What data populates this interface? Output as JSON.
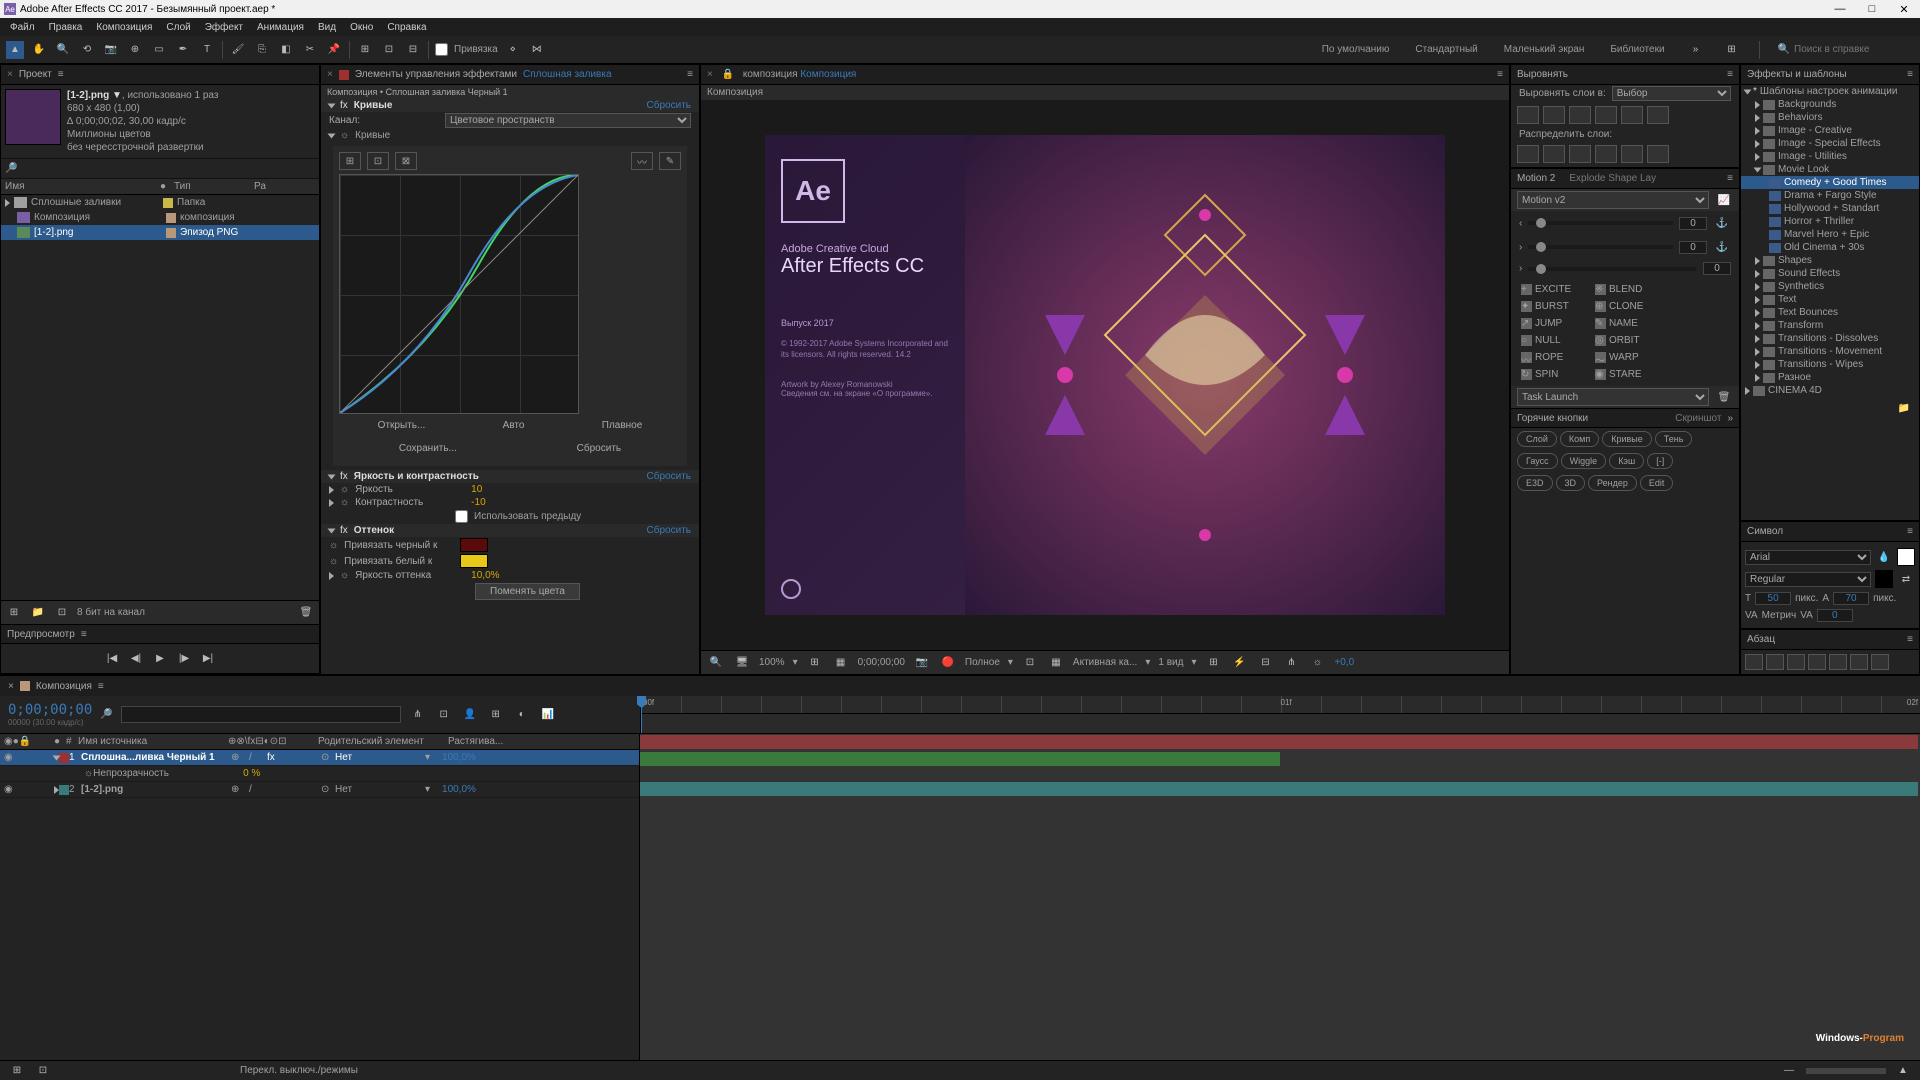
{
  "titlebar": {
    "title": "Adobe After Effects CC 2017 - Безымянный проект.aep *"
  },
  "menubar": [
    "Файл",
    "Правка",
    "Композиция",
    "Слой",
    "Эффект",
    "Анимация",
    "Вид",
    "Окно",
    "Справка"
  ],
  "toolbar": {
    "binding": "Привязка",
    "workspaces": [
      "По умолчанию",
      "Стандартный",
      "Маленький экран",
      "Библиотеки"
    ],
    "search_placeholder": "Поиск в справке"
  },
  "project": {
    "title": "Проект",
    "item_name": "[1-2].png ▼",
    "item_used": ", использовано 1 раз",
    "dim": "680 x 480 (1,00)",
    "dur": "∆ 0;00;00;02, 30,00 кадр/с",
    "colors": "Миллионы цветов",
    "scan": "без чересстрочной развертки",
    "col_name": "Имя",
    "col_type": "Тип",
    "col_size": "Ра",
    "rows": [
      {
        "name": "Сплошные заливки",
        "type": "Папка",
        "color": "#c8b848"
      },
      {
        "name": "Композиция",
        "type": "композиция",
        "color": "#b89878"
      },
      {
        "name": "[1-2].png",
        "type": "Эпизод PNG",
        "color": "#b89878",
        "sel": true
      }
    ],
    "bpc": "8 бит на канал"
  },
  "effects": {
    "title": "Элементы управления эффектами",
    "layer_link": "Сплошная заливка",
    "comp_line": "Композиция • Сплошная заливка Черный 1",
    "fx1": {
      "name": "Кривые",
      "reset": "Сбросить",
      "channel_lbl": "Канал:",
      "channel_val": "Цветовое пространств",
      "curves_lbl": "Кривые",
      "open": "Открыть...",
      "auto": "Авто",
      "smooth": "Плавное",
      "save": "Сохранить...",
      "reset2": "Сбросить"
    },
    "fx2": {
      "name": "Яркость и контрастность",
      "reset": "Сбросить",
      "bright_lbl": "Яркость",
      "bright_val": "10",
      "contrast_lbl": "Контрастность",
      "contrast_val": "-10",
      "legacy": "Использовать предыду"
    },
    "fx3": {
      "name": "Оттенок",
      "reset": "Сбросить",
      "map_black": "Привязать черный к",
      "map_white": "Привязать белый к",
      "amount_lbl": "Яркость оттенка",
      "amount_val": "10,0%",
      "swap": "Поменять цвета"
    }
  },
  "viewer": {
    "tab": "композиция",
    "comp_link": "Композиция",
    "subtab": "Композиция",
    "splash": {
      "brand": "Adobe Creative Cloud",
      "product": "After Effects CC",
      "release": "Выпуск 2017",
      "copyright": "© 1992-2017 Adobe Systems Incorporated and its licensors. All rights reserved. 14.2",
      "artwork": "Artwork by Alexey Romanowski",
      "info": "Сведения см. на экране «О программе»."
    },
    "bottom": {
      "zoom": "100%",
      "time": "0;00;00;00",
      "res": "Полное",
      "cam": "Активная ка...",
      "views": "1 вид",
      "exp": "+0,0"
    }
  },
  "align": {
    "title": "Выровнять",
    "row_lbl": "Выровнять слои в:",
    "sel": "Выбор",
    "dist_lbl": "Распределить слои:"
  },
  "motion": {
    "tab1": "Motion 2",
    "tab2": "Explode Shape Lay",
    "preset": "Motion v2",
    "slider_val": "0",
    "buttons": [
      "EXCITE",
      "BLEND",
      "BURST",
      "CLONE",
      "JUMP",
      "NAME",
      "NULL",
      "ORBIT",
      "ROPE",
      "WARP",
      "SPIN",
      "STARE"
    ],
    "task": "Task Launch",
    "hotkeys": "Горячие кнопки",
    "screenshot": "Скриншот",
    "pills1": [
      "Слой",
      "Комп",
      "Кривые",
      "Тень"
    ],
    "pills2": [
      "Гаусс",
      "Wiggle",
      "Кэш",
      "[-]"
    ],
    "pills3": [
      "E3D",
      "3D",
      "Рендер",
      "Edit"
    ]
  },
  "presets": {
    "title": "Эффекты и шаблоны",
    "root": "Шаблоны настроек анимации",
    "folders": [
      "Backgrounds",
      "Behaviors",
      "Image - Creative",
      "Image - Special Effects",
      "Image - Utilities",
      "Movie Look"
    ],
    "movie_look": [
      "Comedy + Good Times",
      "Drama + Fargo Style",
      "Hollywood + Standart",
      "Horror + Thriller",
      "Marvel Hero + Epic",
      "Old Cinema + 30s"
    ],
    "folders2": [
      "Shapes",
      "Sound Effects",
      "Synthetics",
      "Text",
      "Text Bounces",
      "Transform",
      "Transitions - Dissolves",
      "Transitions - Movement",
      "Transitions - Wipes",
      "Разное",
      "CINEMA 4D"
    ]
  },
  "character": {
    "title": "Символ",
    "font": "Arial",
    "style": "Regular",
    "size": "50",
    "size_unit": "пикс.",
    "leading": "70",
    "tracking_lbl": "Метрич"
  },
  "paragraph": {
    "title": "Абзац"
  },
  "preview": {
    "title": "Предпросмотр"
  },
  "timeline": {
    "tab": "Композиция",
    "timecode": "0;00;00;00",
    "fps": "00000 (30.00 кадр/с)",
    "ruler": {
      "t1": "00f",
      "t2": "01f",
      "t3": "02f"
    },
    "cols": {
      "src": "Имя источника",
      "parent": "Родительский элемент",
      "stretch": "Растягива..."
    },
    "layers": [
      {
        "num": "1",
        "name": "Сплошна...ливка Черный 1",
        "parent": "Нет",
        "stretch": "100,0%",
        "sel": true,
        "color": "#a03030"
      },
      {
        "prop": "Непрозрачность",
        "val": "0 %"
      },
      {
        "num": "2",
        "name": "[1-2].png",
        "parent": "Нет",
        "stretch": "100,0%",
        "color": "#3a7a7a"
      }
    ],
    "bottom": "Перекл. выключ./режимы"
  },
  "watermark": {
    "p1": "Windows-",
    "p2": "Program"
  }
}
